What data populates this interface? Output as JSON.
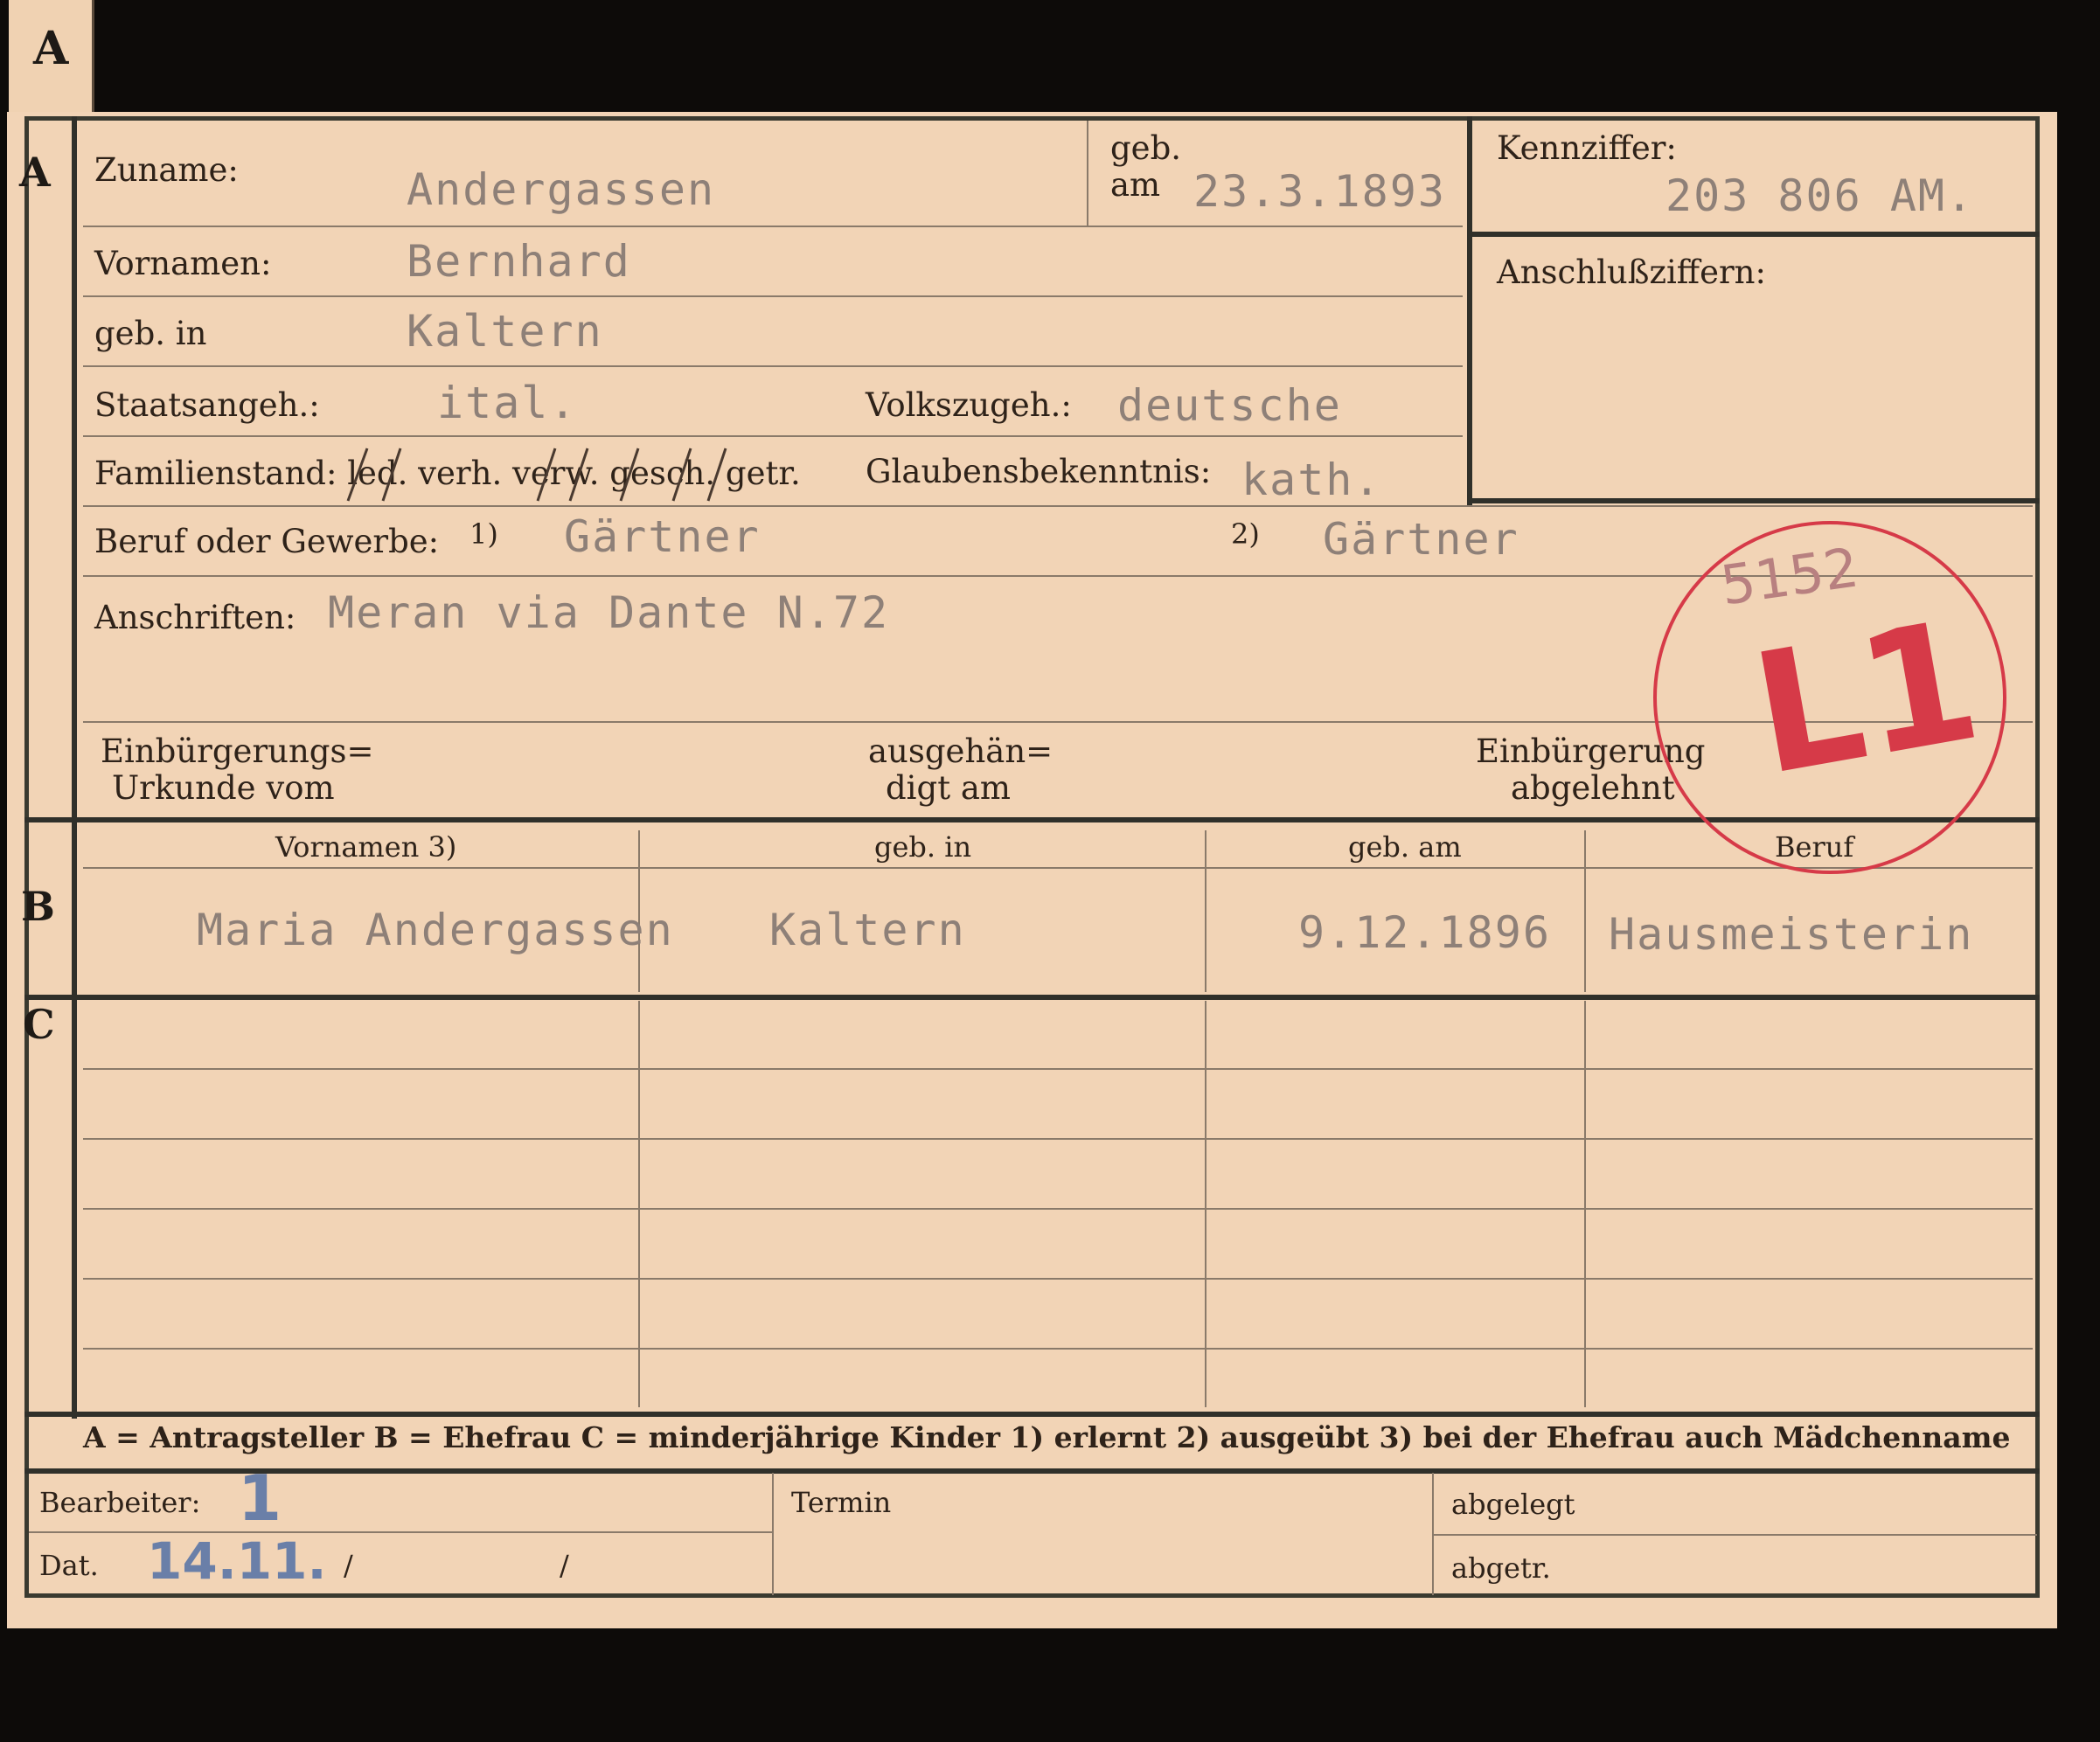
{
  "corner_tab": "A",
  "sections": {
    "a": "A",
    "b": "B",
    "c": "C"
  },
  "section_a": {
    "zuname_label": "Zuname:",
    "zuname_value": "Andergassen",
    "geb_label": "geb.",
    "am_label": "am",
    "geb_am_value": "23.3.1893",
    "kennziffer_label": "Kennziffer:",
    "kennziffer_value": "203 806 AM.",
    "vornamen_label": "Vornamen:",
    "vornamen_value": "Bernhard",
    "anschlussziffern_label": "Anschlußziffern:",
    "geb_in_label": "geb. in",
    "geb_in_value": "Kaltern",
    "staatsangeh_label": "Staatsangeh.:",
    "staatsangeh_value": "ital.",
    "volkszugeh_label": "Volkszugeh.:",
    "volkszugeh_value": "deutsche",
    "familienstand_label": "Familienstand: led. verh. verw. gesch. getr.",
    "glaubensbekenntnis_label": "Glaubensbekenntnis:",
    "glaubensbekenntnis_value": "kath.",
    "beruf_label": "Beruf oder Gewerbe:",
    "beruf_note1": "1)",
    "beruf_value1": "Gärtner",
    "beruf_note2": "2)",
    "beruf_value2": "Gärtner",
    "anschriften_label": "Anschriften:",
    "anschriften_value": "Meran via Dante N.72",
    "einbuergerung_line1": "Einbürgerungs=",
    "einbuergerung_line2": "Urkunde vom",
    "ausgehaendigt_line1": "ausgehän=",
    "ausgehaendigt_line2": "digt am",
    "abgelehnt_line1": "Einbürgerung",
    "abgelehnt_line2": "abgelehnt"
  },
  "stamp": {
    "code": "L1",
    "handwritten": "5152",
    "color": "#d63a48"
  },
  "section_b": {
    "headers": [
      "Vornamen 3)",
      "geb. in",
      "geb. am",
      "Beruf"
    ],
    "row": [
      "Maria Andergassen",
      "Kaltern",
      "9.12.1896",
      "Hausmeisterin"
    ]
  },
  "legend": "A = Antragsteller   B = Ehefrau   C = minderjährige Kinder   1) erlernt   2) ausgeübt   3) bei der Ehefrau auch Mädchenname",
  "footer": {
    "bearbeiter_label": "Bearbeiter:",
    "bearbeiter_value": "1",
    "dat_label": "Dat.",
    "dat_value": "14.11.",
    "slash1": "/",
    "slash2": "/",
    "termin_label": "Termin",
    "abgelegt_label": "abgelegt",
    "abgetr_label": "abgetr."
  },
  "colors": {
    "card": "#f2d4b6",
    "ink": "#2e2219",
    "typed": "#8e8078",
    "stamp": "#d63a48",
    "pencil": "#6a7fa8"
  }
}
